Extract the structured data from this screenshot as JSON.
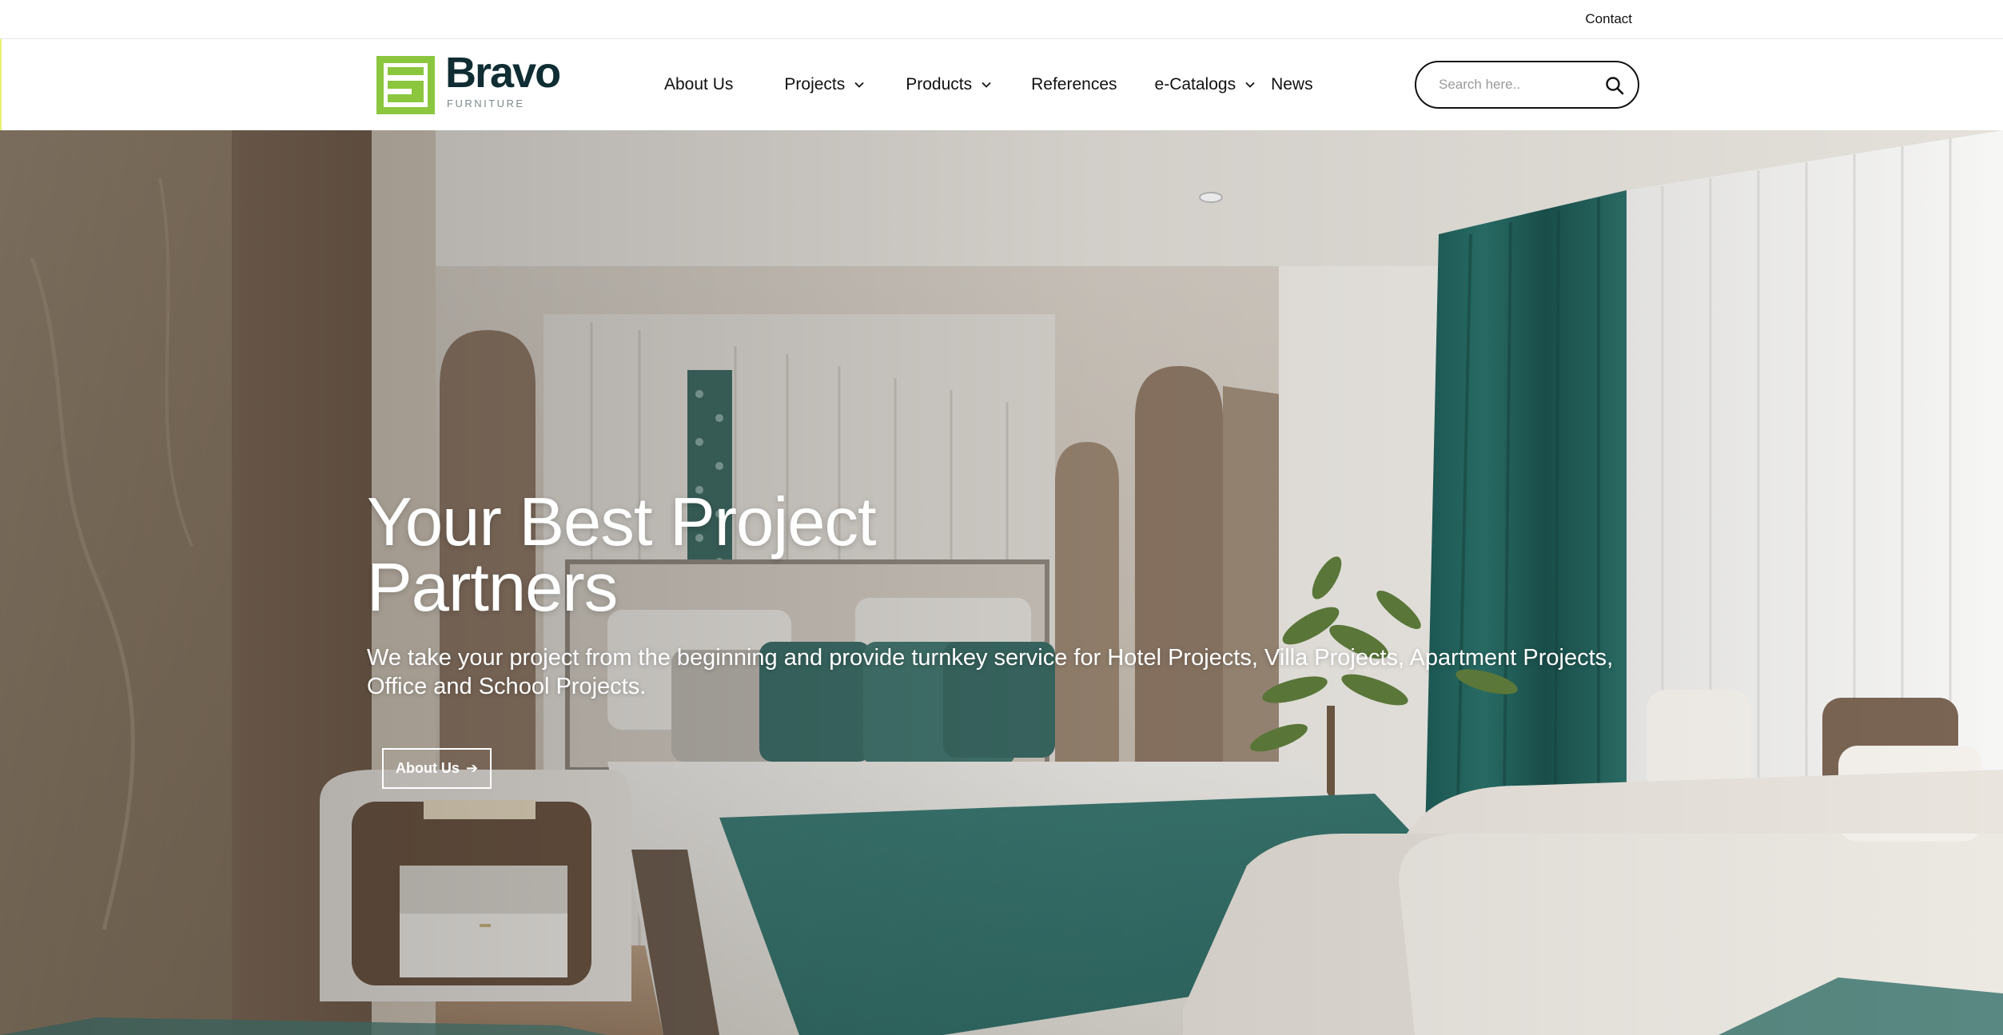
{
  "topbar": {
    "contact_label": "Contact"
  },
  "brand": {
    "name": "Bravo",
    "subtitle": "FURNITURE",
    "logo_icon": "bravo-logo-mark",
    "colors": {
      "green": "#8cc63f",
      "dark": "#0f2d33"
    }
  },
  "nav": {
    "items": [
      {
        "label": "About Us",
        "has_dropdown": false
      },
      {
        "label": "Projects",
        "has_dropdown": true
      },
      {
        "label": "Products",
        "has_dropdown": true
      },
      {
        "label": "References",
        "has_dropdown": false
      },
      {
        "label": "e-Catalogs",
        "has_dropdown": true
      },
      {
        "label": "News",
        "has_dropdown": false
      }
    ]
  },
  "search": {
    "placeholder": "Search here..",
    "value": "",
    "icon": "search-icon"
  },
  "hero": {
    "title_line1": "Your Best Project",
    "title_line2": "Partners",
    "subtitle": "We take your project from the beginning and provide turnkey service for Hotel Projects, Villa Projects, Apartment Projects, Office and School Projects.",
    "cta_label": "About Us",
    "cta_icon": "arrow-right-icon",
    "image_subject": "hotel bedroom interior"
  }
}
